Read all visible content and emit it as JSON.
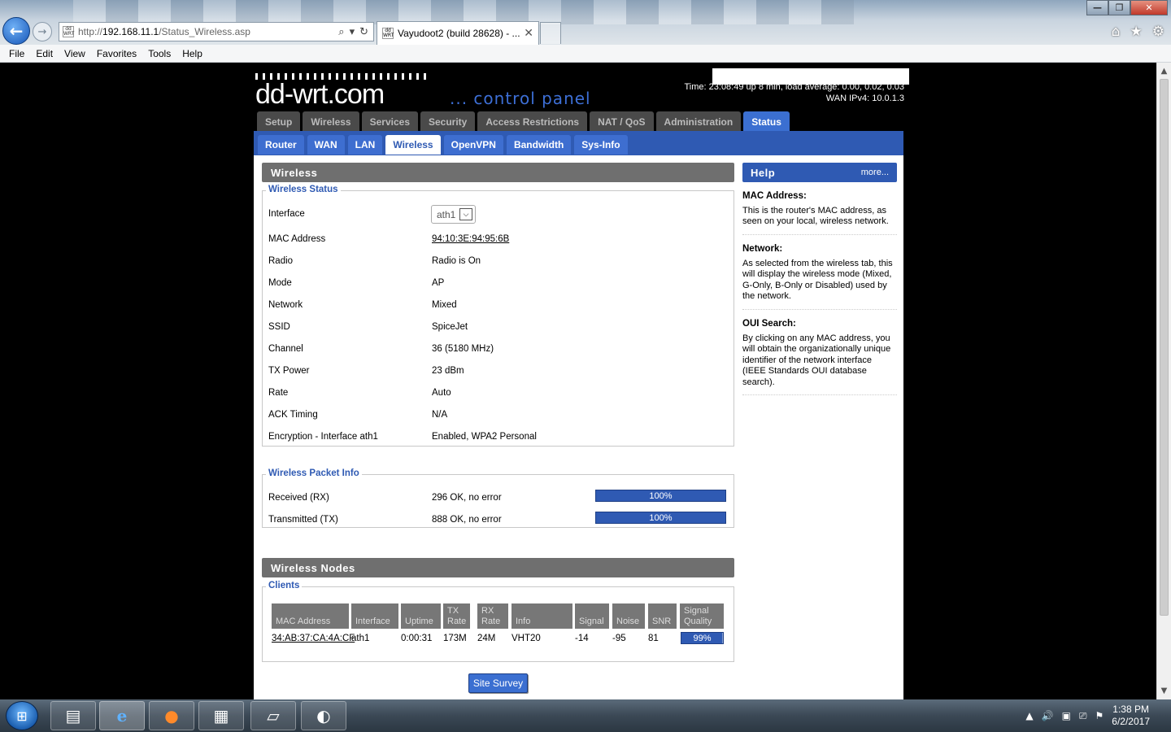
{
  "browser": {
    "url_prefix": "http://",
    "url_host": "192.168.11.1",
    "url_path": "/Status_Wireless.asp",
    "tab_title": "Vayudoot2 (build 28628) - ...",
    "favicon_text": "dd WRT",
    "menu": [
      "File",
      "Edit",
      "View",
      "Favorites",
      "Tools",
      "Help"
    ]
  },
  "header": {
    "logo": "dd-wrt.com",
    "subtitle": "... control panel",
    "time_line": "Time: 23:08:49 up 8 min, load average: 0.00, 0.02, 0.03",
    "wan_line": "WAN IPv4: 10.0.1.3"
  },
  "main_tabs": [
    "Setup",
    "Wireless",
    "Services",
    "Security",
    "Access Restrictions",
    "NAT / QoS",
    "Administration",
    "Status"
  ],
  "active_main_tab": "Status",
  "sub_tabs": [
    "Router",
    "WAN",
    "LAN",
    "Wireless",
    "OpenVPN",
    "Bandwidth",
    "Sys-Info"
  ],
  "active_sub_tab": "Wireless",
  "wireless": {
    "section_title": "Wireless",
    "status_legend": "Wireless Status",
    "interface_label": "Interface",
    "interface_value": "ath1",
    "rows": [
      {
        "label": "MAC Address",
        "value": "94:10:3E:94:95:6B"
      },
      {
        "label": "Radio",
        "value": "Radio is On"
      },
      {
        "label": "Mode",
        "value": "AP"
      },
      {
        "label": "Network",
        "value": "Mixed"
      },
      {
        "label": "SSID",
        "value": "SpiceJet"
      },
      {
        "label": "Channel",
        "value": "36 (5180 MHz)"
      },
      {
        "label": "TX Power",
        "value": "23 dBm"
      },
      {
        "label": "Rate",
        "value": "Auto"
      },
      {
        "label": "ACK Timing",
        "value": "N/A"
      },
      {
        "label": "Encryption - Interface ath1",
        "value": "Enabled, WPA2 Personal"
      }
    ]
  },
  "packet_info": {
    "legend": "Wireless Packet Info",
    "rx": {
      "label": "Received (RX)",
      "value": "296 OK, no error",
      "percent_text": "100%",
      "percent": 100
    },
    "tx": {
      "label": "Transmitted (TX)",
      "value": "888 OK, no error",
      "percent_text": "100%",
      "percent": 100
    }
  },
  "nodes": {
    "section_title": "Wireless Nodes",
    "clients_legend": "Clients",
    "columns": [
      "MAC Address",
      "Interface",
      "Uptime",
      "TX Rate",
      "RX Rate",
      "Info",
      "Signal",
      "Noise",
      "SNR",
      "Signal Quality"
    ],
    "client": {
      "mac": "34:AB:37:CA:4A:CF",
      "interface": "ath1",
      "uptime": "0:00:31",
      "tx_rate": "173M",
      "rx_rate": "24M",
      "info": "VHT20",
      "signal": "-14",
      "noise": "-95",
      "snr": "81",
      "quality_text": "99%",
      "quality": 99
    },
    "site_survey_label": "Site Survey"
  },
  "help": {
    "title": "Help",
    "more": "more...",
    "blocks": [
      {
        "heading": "MAC Address:",
        "text": "This is the router's MAC address, as seen on your local, wireless network."
      },
      {
        "heading": "Network:",
        "text": "As selected from the wireless tab, this will display the wireless mode (Mixed, G-Only, B-Only or Disabled) used by the network."
      },
      {
        "heading": "OUI Search:",
        "text": "By clicking on any MAC address, you will obtain the organizationally unique identifier of the network interface (IEEE Standards OUI database search)."
      }
    ]
  },
  "taskbar": {
    "time": "1:38 PM",
    "date": "6/2/2017"
  }
}
